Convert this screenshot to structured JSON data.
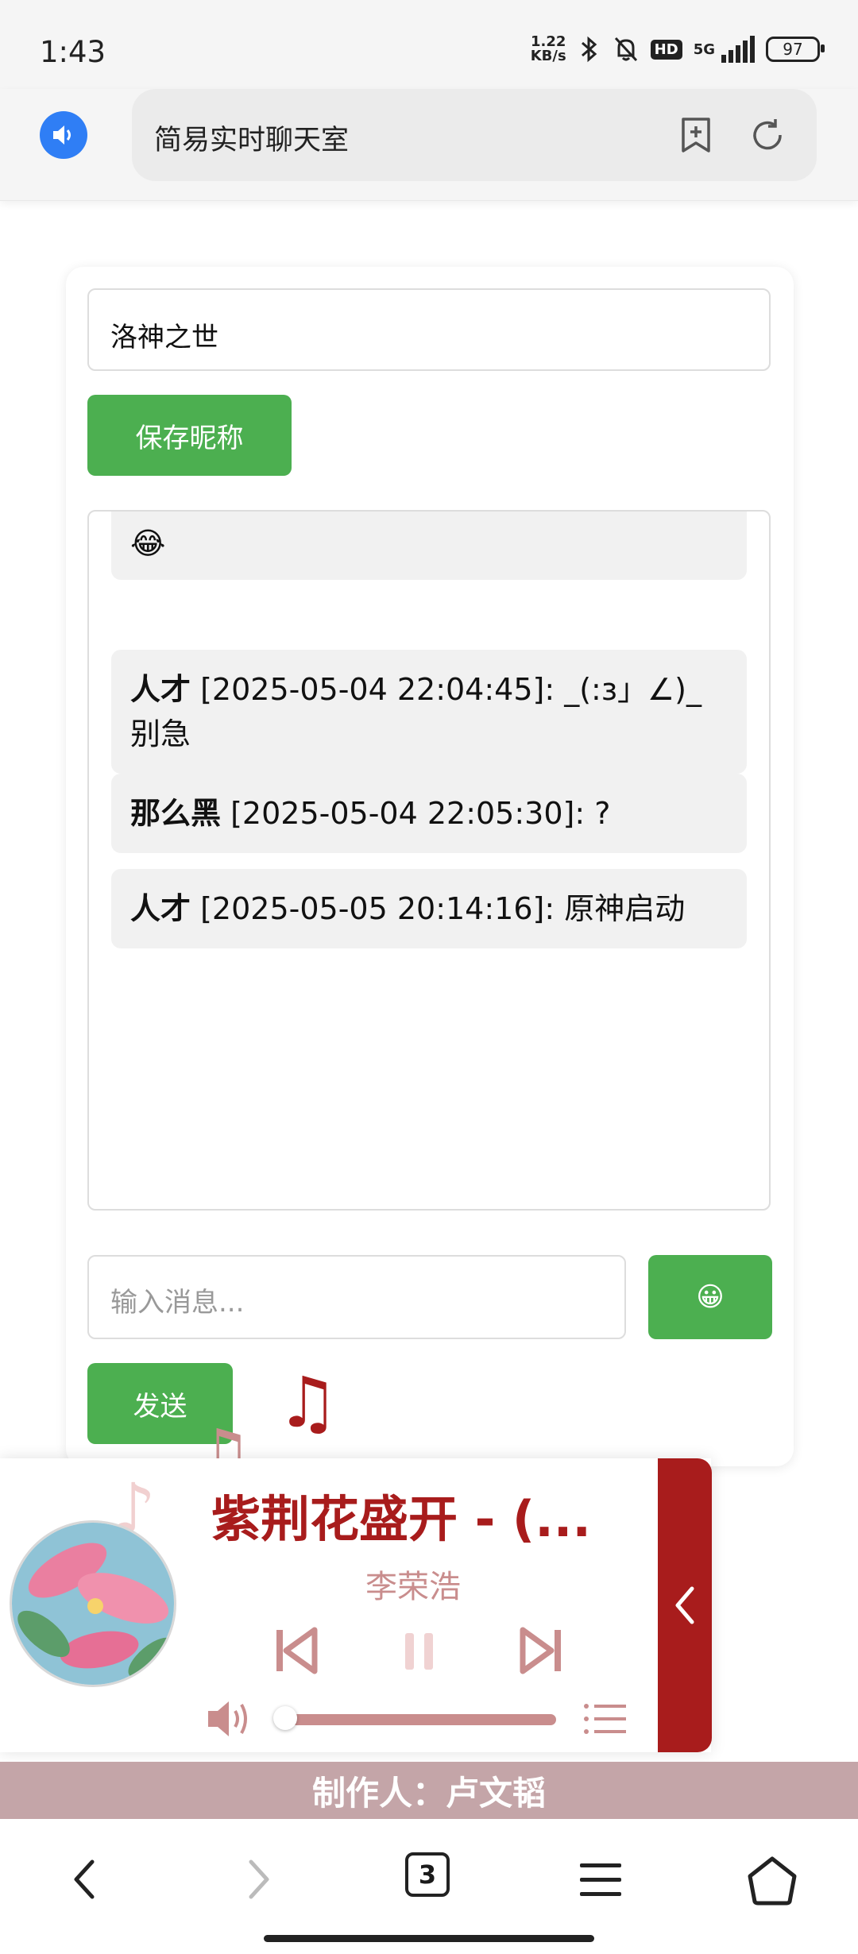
{
  "status_bar": {
    "time": "1:43",
    "net_speed_value": "1.22",
    "net_speed_unit": "KB/s",
    "hd_badge": "HD",
    "network_type": "5G",
    "battery": "97"
  },
  "browser": {
    "page_title": "简易实时聊天室",
    "tab_count": "3"
  },
  "chat_app": {
    "nickname_value": "洛神之世",
    "save_nickname_label": "保存昵称",
    "messages": [
      {
        "text": "😂"
      },
      {
        "user": "人才",
        "time": "[2025-05-04 22:04:45]",
        "text": ": _(:з」∠)_别急"
      },
      {
        "user": "那么黑",
        "time": "[2025-05-04 22:05:30]",
        "text": ": ?"
      },
      {
        "user": "人才",
        "time": "[2025-05-05 20:14:16]",
        "text": ": 原神启动"
      }
    ],
    "message_placeholder": "输入消息...",
    "emoji_button": "😀",
    "send_label": "发送"
  },
  "music_player": {
    "song_title": "紫荆花盛开 - (...",
    "artist": "李荣浩",
    "progress_fraction": 0.0
  },
  "credit": "制作人：卢文韬",
  "colors": {
    "accent_green": "#4caf50",
    "player_red": "#a81c1c",
    "player_muted": "#c98d8d",
    "credit_bg": "#c4a5a8",
    "speaker_blue": "#2f7ef5"
  }
}
